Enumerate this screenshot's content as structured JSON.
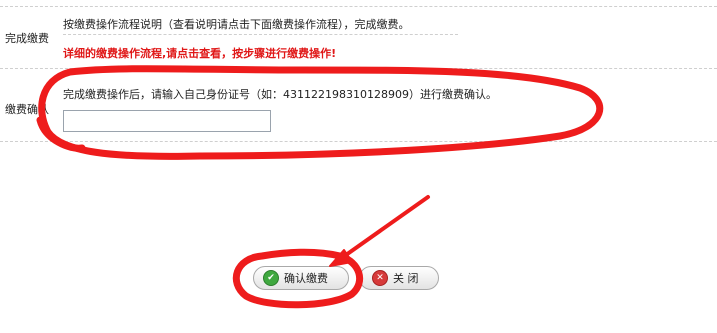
{
  "sections": {
    "complete_payment": {
      "label": "完成缴费",
      "instruction": "按缴费操作流程说明（查看说明请点击下面缴费操作流程），完成缴费。",
      "warning": "详细的缴费操作流程,请点击查看，按步骤进行缴费操作!"
    },
    "payment_confirm": {
      "label": "缴费确认",
      "instruction": "完成缴费操作后，请输入自己身份证号（如：431122198310128909）进行缴费确认。",
      "id_input_value": "",
      "id_input_placeholder": ""
    }
  },
  "buttons": {
    "confirm_label": "确认缴费",
    "close_label": "关 闭"
  },
  "colors": {
    "warning": "#e01818",
    "annotation": "#ee1c1c",
    "confirm_icon": "#3fa83f",
    "close_icon": "#d63a3a"
  },
  "icons": {
    "confirm": "check-circle-icon",
    "close": "x-circle-icon"
  }
}
